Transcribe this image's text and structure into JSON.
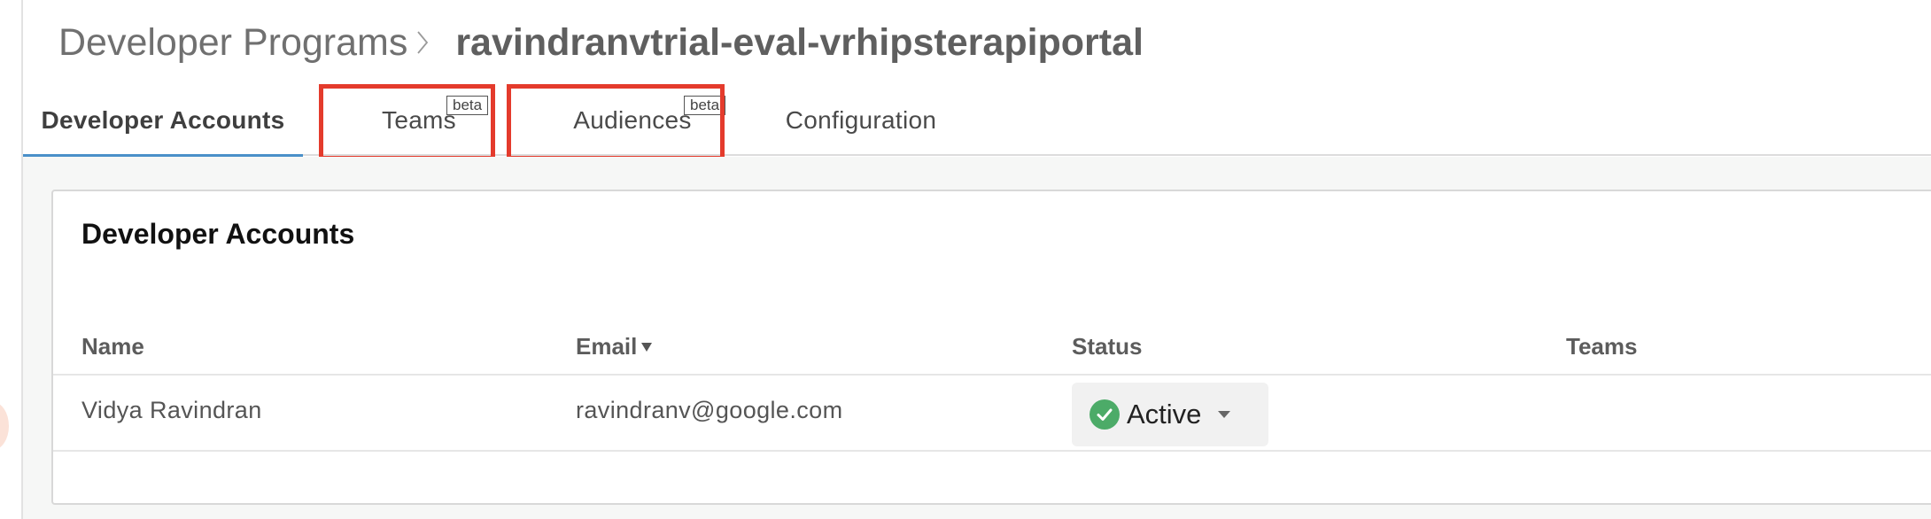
{
  "breadcrumb": {
    "parent": "Developer Programs",
    "current": "ravindranvtrial-eval-vrhipsterapiportal"
  },
  "tabs": [
    {
      "label": "Developer Accounts",
      "active": true
    },
    {
      "label": "Teams",
      "badge": "beta",
      "highlighted": true
    },
    {
      "label": "Audiences",
      "badge": "beta",
      "highlighted": true
    },
    {
      "label": "Configuration"
    }
  ],
  "card": {
    "title": "Developer Accounts",
    "columns": {
      "name": "Name",
      "email": "Email",
      "status": "Status",
      "teams": "Teams"
    },
    "sort": {
      "column": "email",
      "icon": "sort-down-icon"
    },
    "rows": [
      {
        "name": "Vidya Ravindran",
        "email": "ravindranv@google.com",
        "status": "Active",
        "teams": ""
      }
    ]
  },
  "colors": {
    "highlight": "#e43b2c",
    "active_tab_underline": "#4a90c9",
    "status_active": "#4cab68"
  },
  "icons": {
    "breadcrumb_separator": "chevron-right-icon",
    "status": "check-circle-icon",
    "status_dropdown": "caret-down-icon"
  }
}
